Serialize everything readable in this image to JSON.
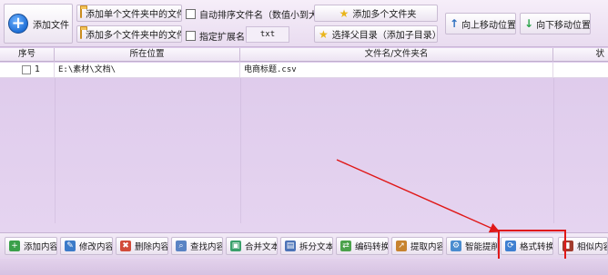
{
  "toolbar": {
    "add_file": "添加文件",
    "add_files_single_folder": "添加单个文件夹中的文件",
    "add_files_multi_folder": "添加多个文件夹中的文件",
    "auto_sort": "自动排序文件名（数值小到大）",
    "specify_ext": "指定扩展名:",
    "ext_value": "txt",
    "add_multi_folder": "添加多个文件夹",
    "select_parent_dir": "选择父目录（添加子目录）",
    "move_up": "向上移动位置",
    "move_down": "向下移动位置"
  },
  "table": {
    "columns": [
      "序号",
      "所在位置",
      "文件名/文件夹名",
      "状"
    ],
    "rows": [
      {
        "index": "1",
        "location": "E:\\素材\\文档\\",
        "filename": "电商标题.csv"
      }
    ]
  },
  "bottom": {
    "buttons": [
      {
        "label": "添加内容",
        "icon": "add-content-icon",
        "color": "#3aa04a"
      },
      {
        "label": "修改内容",
        "icon": "edit-content-icon",
        "color": "#3c7bc9"
      },
      {
        "label": "删除内容",
        "icon": "delete-content-icon",
        "color": "#d24b3a"
      },
      {
        "label": "查找内容",
        "icon": "find-content-icon",
        "color": "#5a84c4"
      },
      {
        "label": "合并文本",
        "icon": "merge-text-icon",
        "color": "#3aa06b"
      },
      {
        "label": "拆分文本",
        "icon": "split-text-icon",
        "color": "#4d74b8"
      },
      {
        "label": "编码转换",
        "icon": "encoding-convert-icon",
        "color": "#4ba24b"
      },
      {
        "label": "提取内容",
        "icon": "extract-content-icon",
        "color": "#c7832f"
      },
      {
        "label": "智能提削",
        "icon": "smart-extract-icon",
        "color": "#4a8ccf"
      },
      {
        "label": "格式转换",
        "icon": "format-convert-icon",
        "color": "#3e7fd1"
      },
      {
        "label": "相似内容",
        "icon": "similar-content-icon",
        "color": "#a13b2d"
      }
    ]
  },
  "annotation": {
    "color": "#e01818"
  }
}
